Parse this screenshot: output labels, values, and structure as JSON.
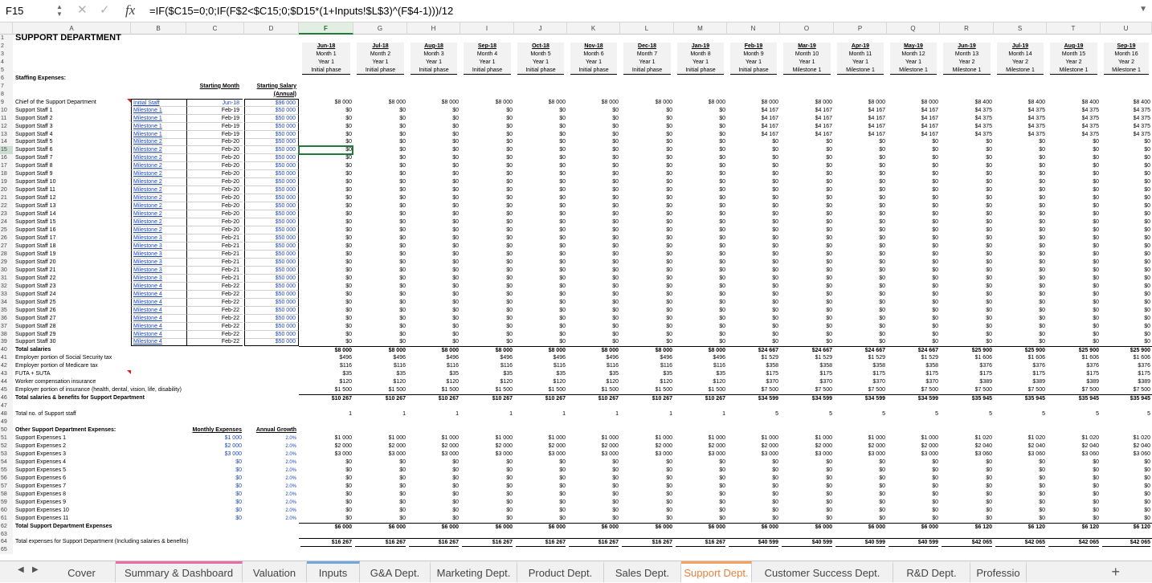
{
  "formula_bar": {
    "name_box": "F15",
    "fx_label": "fx",
    "formula": "=IF($C15=0;0;IF(F$2<$C15;0;$D15*(1+Inputs!$L$3)^(F$4-1)))/12"
  },
  "column_headers": [
    "A",
    "B",
    "C",
    "D",
    "F",
    "G",
    "H",
    "I",
    "J",
    "K",
    "L",
    "M",
    "N",
    "O",
    "P",
    "Q",
    "R",
    "S",
    "T",
    "U"
  ],
  "selected_column": "F",
  "title": "SUPPORT DEPARTMENT",
  "months": [
    {
      "date": "Jun-18",
      "month": "Month 1",
      "year": "Year 1",
      "phase": "Initial phase"
    },
    {
      "date": "Jul-18",
      "month": "Month 2",
      "year": "Year 1",
      "phase": "Initial phase"
    },
    {
      "date": "Aug-18",
      "month": "Month 3",
      "year": "Year 1",
      "phase": "Initial phase"
    },
    {
      "date": "Sep-18",
      "month": "Month 4",
      "year": "Year 1",
      "phase": "Initial phase"
    },
    {
      "date": "Oct-18",
      "month": "Month 5",
      "year": "Year 1",
      "phase": "Initial phase"
    },
    {
      "date": "Nov-18",
      "month": "Month 6",
      "year": "Year 1",
      "phase": "Initial phase"
    },
    {
      "date": "Dec-18",
      "month": "Month 7",
      "year": "Year 1",
      "phase": "Initial phase"
    },
    {
      "date": "Jan-19",
      "month": "Month 8",
      "year": "Year 1",
      "phase": "Initial phase"
    },
    {
      "date": "Feb-19",
      "month": "Month 9",
      "year": "Year 1",
      "phase": "Initial phase"
    },
    {
      "date": "Mar-19",
      "month": "Month 10",
      "year": "Year 1",
      "phase": "Milestone 1"
    },
    {
      "date": "Apr-19",
      "month": "Month 11",
      "year": "Year 1",
      "phase": "Milestone 1"
    },
    {
      "date": "May-19",
      "month": "Month 12",
      "year": "Year 1",
      "phase": "Milestone 1"
    },
    {
      "date": "Jun-19",
      "month": "Month 13",
      "year": "Year 2",
      "phase": "Milestone 1"
    },
    {
      "date": "Jul-19",
      "month": "Month 14",
      "year": "Year 2",
      "phase": "Milestone 1"
    },
    {
      "date": "Aug-19",
      "month": "Month 15",
      "year": "Year 2",
      "phase": "Milestone 1"
    },
    {
      "date": "Sep-19",
      "month": "Month 16",
      "year": "Year 2",
      "phase": "Milestone 1"
    }
  ],
  "staffing_label": "Staffing Expenses:",
  "starting_month_header": "Starting Month",
  "starting_salary_header": "Starting Salary",
  "starting_salary_header2": "(Annual)",
  "staff": [
    {
      "name": "Chief of the Support Department",
      "milestone": "Initial Staff",
      "start": "Jun-18",
      "salary": "$96 000"
    },
    {
      "name": "Support Staff 1",
      "milestone": "Milestone 1",
      "start": "Feb-19",
      "salary": "$50 000"
    },
    {
      "name": "Support Staff 2",
      "milestone": "Milestone 1",
      "start": "Feb-19",
      "salary": "$50 000"
    },
    {
      "name": "Support Staff 3",
      "milestone": "Milestone 1",
      "start": "Feb-19",
      "salary": "$50 000"
    },
    {
      "name": "Support Staff 4",
      "milestone": "Milestone 1",
      "start": "Feb-19",
      "salary": "$50 000"
    },
    {
      "name": "Support Staff 5",
      "milestone": "Milestone 2",
      "start": "Feb-20",
      "salary": "$50 000"
    },
    {
      "name": "Support Staff 6",
      "milestone": "Milestone 2",
      "start": "Feb-20",
      "salary": "$50 000"
    },
    {
      "name": "Support Staff 7",
      "milestone": "Milestone 2",
      "start": "Feb-20",
      "salary": "$50 000"
    },
    {
      "name": "Support Staff 8",
      "milestone": "Milestone 2",
      "start": "Feb-20",
      "salary": "$50 000"
    },
    {
      "name": "Support Staff 9",
      "milestone": "Milestone 2",
      "start": "Feb-20",
      "salary": "$50 000"
    },
    {
      "name": "Support Staff 10",
      "milestone": "Milestone 2",
      "start": "Feb-20",
      "salary": "$50 000"
    },
    {
      "name": "Support Staff 11",
      "milestone": "Milestone 2",
      "start": "Feb-20",
      "salary": "$50 000"
    },
    {
      "name": "Support Staff 12",
      "milestone": "Milestone 2",
      "start": "Feb-20",
      "salary": "$50 000"
    },
    {
      "name": "Support Staff 13",
      "milestone": "Milestone 2",
      "start": "Feb-20",
      "salary": "$50 000"
    },
    {
      "name": "Support Staff 14",
      "milestone": "Milestone 2",
      "start": "Feb-20",
      "salary": "$50 000"
    },
    {
      "name": "Support Staff 15",
      "milestone": "Milestone 2",
      "start": "Feb-20",
      "salary": "$50 000"
    },
    {
      "name": "Support Staff 16",
      "milestone": "Milestone 2",
      "start": "Feb-20",
      "salary": "$50 000"
    },
    {
      "name": "Support Staff 17",
      "milestone": "Milestone 3",
      "start": "Feb-21",
      "salary": "$50 000"
    },
    {
      "name": "Support Staff 18",
      "milestone": "Milestone 3",
      "start": "Feb-21",
      "salary": "$50 000"
    },
    {
      "name": "Support Staff 19",
      "milestone": "Milestone 3",
      "start": "Feb-21",
      "salary": "$50 000"
    },
    {
      "name": "Support Staff 20",
      "milestone": "Milestone 3",
      "start": "Feb-21",
      "salary": "$50 000"
    },
    {
      "name": "Support Staff 21",
      "milestone": "Milestone 3",
      "start": "Feb-21",
      "salary": "$50 000"
    },
    {
      "name": "Support Staff 22",
      "milestone": "Milestone 3",
      "start": "Feb-21",
      "salary": "$50 000"
    },
    {
      "name": "Support Staff 23",
      "milestone": "Milestone 4",
      "start": "Feb-22",
      "salary": "$50 000"
    },
    {
      "name": "Support Staff 24",
      "milestone": "Milestone 4",
      "start": "Feb-22",
      "salary": "$50 000"
    },
    {
      "name": "Support Staff 25",
      "milestone": "Milestone 4",
      "start": "Feb-22",
      "salary": "$50 000"
    },
    {
      "name": "Support Staff 26",
      "milestone": "Milestone 4",
      "start": "Feb-22",
      "salary": "$50 000"
    },
    {
      "name": "Support Staff 27",
      "milestone": "Milestone 4",
      "start": "Feb-22",
      "salary": "$50 000"
    },
    {
      "name": "Support Staff 28",
      "milestone": "Milestone 4",
      "start": "Feb-22",
      "salary": "$50 000"
    },
    {
      "name": "Support Staff 29",
      "milestone": "Milestone 4",
      "start": "Feb-22",
      "salary": "$50 000"
    },
    {
      "name": "Support Staff 30",
      "milestone": "Milestone 4",
      "start": "Feb-22",
      "salary": "$50 000"
    }
  ],
  "staff_values": {
    "chief": [
      "$8 000",
      "$8 000",
      "$8 000",
      "$8 000",
      "$8 000",
      "$8 000",
      "$8 000",
      "$8 000",
      "$8 000",
      "$8 000",
      "$8 000",
      "$8 000",
      "$8 400",
      "$8 400",
      "$8 400",
      "$8 400"
    ],
    "milestone1": [
      "$0",
      "$0",
      "$0",
      "$0",
      "$0",
      "$0",
      "$0",
      "$0",
      "$4 167",
      "$4 167",
      "$4 167",
      "$4 167",
      "$4 375",
      "$4 375",
      "$4 375",
      "$4 375"
    ],
    "zero": "$0"
  },
  "totals": [
    {
      "label": "Total salaries",
      "bold": true,
      "values": [
        "$8 000",
        "$8 000",
        "$8 000",
        "$8 000",
        "$8 000",
        "$8 000",
        "$8 000",
        "$8 000",
        "$24 667",
        "$24 667",
        "$24 667",
        "$24 667",
        "$25 900",
        "$25 900",
        "$25 900",
        "$25 900"
      ]
    },
    {
      "label": "Employer portion of Social Security tax",
      "bold": false,
      "values": [
        "$496",
        "$496",
        "$496",
        "$496",
        "$496",
        "$496",
        "$496",
        "$496",
        "$1 529",
        "$1 529",
        "$1 529",
        "$1 529",
        "$1 606",
        "$1 606",
        "$1 606",
        "$1 606"
      ]
    },
    {
      "label": "Employer portion of Medicare tax",
      "bold": false,
      "values": [
        "$116",
        "$116",
        "$116",
        "$116",
        "$116",
        "$116",
        "$116",
        "$116",
        "$358",
        "$358",
        "$358",
        "$358",
        "$376",
        "$376",
        "$376",
        "$376"
      ]
    },
    {
      "label": "FUTA + SUTA",
      "bold": false,
      "values": [
        "$35",
        "$35",
        "$35",
        "$35",
        "$35",
        "$35",
        "$35",
        "$35",
        "$175",
        "$175",
        "$175",
        "$175",
        "$175",
        "$175",
        "$175",
        "$175"
      ]
    },
    {
      "label": "Worker compensation insurance",
      "bold": false,
      "values": [
        "$120",
        "$120",
        "$120",
        "$120",
        "$120",
        "$120",
        "$120",
        "$120",
        "$370",
        "$370",
        "$370",
        "$370",
        "$389",
        "$389",
        "$389",
        "$389"
      ]
    },
    {
      "label": "Employer portion of insurance (health, dental, vision, life, disability)",
      "bold": false,
      "values": [
        "$1 500",
        "$1 500",
        "$1 500",
        "$1 500",
        "$1 500",
        "$1 500",
        "$1 500",
        "$1 500",
        "$7 500",
        "$7 500",
        "$7 500",
        "$7 500",
        "$7 500",
        "$7 500",
        "$7 500",
        "$7 500"
      ]
    },
    {
      "label": "Total salaries & benefits for Support Department",
      "bold": true,
      "values": [
        "$10 267",
        "$10 267",
        "$10 267",
        "$10 267",
        "$10 267",
        "$10 267",
        "$10 267",
        "$10 267",
        "$34 599",
        "$34 599",
        "$34 599",
        "$34 599",
        "$35 945",
        "$35 945",
        "$35 945",
        "$35 945"
      ]
    }
  ],
  "staff_count": {
    "label": "Total no. of Support staff",
    "values": [
      "1",
      "1",
      "1",
      "1",
      "1",
      "1",
      "1",
      "1",
      "5",
      "5",
      "5",
      "5",
      "5",
      "5",
      "5",
      "5"
    ]
  },
  "other_label": "Other Support Department Expenses:",
  "monthly_expenses_header": "Monthly Expenses",
  "annual_growth_header": "Annual Growth",
  "other_expenses": [
    {
      "name": "Support Expenses 1",
      "monthly": "$1 000",
      "growth": "2.0%",
      "values": [
        "$1 000",
        "$1 000",
        "$1 000",
        "$1 000",
        "$1 000",
        "$1 000",
        "$1 000",
        "$1 000",
        "$1 000",
        "$1 000",
        "$1 000",
        "$1 000",
        "$1 020",
        "$1 020",
        "$1 020",
        "$1 020"
      ]
    },
    {
      "name": "Support Expenses 2",
      "monthly": "$2 000",
      "growth": "2.0%",
      "values": [
        "$2 000",
        "$2 000",
        "$2 000",
        "$2 000",
        "$2 000",
        "$2 000",
        "$2 000",
        "$2 000",
        "$2 000",
        "$2 000",
        "$2 000",
        "$2 000",
        "$2 040",
        "$2 040",
        "$2 040",
        "$2 040"
      ]
    },
    {
      "name": "Support Expenses 3",
      "monthly": "$3 000",
      "growth": "2.0%",
      "values": [
        "$3 000",
        "$3 000",
        "$3 000",
        "$3 000",
        "$3 000",
        "$3 000",
        "$3 000",
        "$3 000",
        "$3 000",
        "$3 000",
        "$3 000",
        "$3 000",
        "$3 060",
        "$3 060",
        "$3 060",
        "$3 060"
      ]
    },
    {
      "name": "Support Expenses 4",
      "monthly": "$0",
      "growth": "2.0%",
      "values": []
    },
    {
      "name": "Support Expenses 5",
      "monthly": "$0",
      "growth": "2.0%",
      "values": []
    },
    {
      "name": "Support Expenses 6",
      "monthly": "$0",
      "growth": "2.0%",
      "values": []
    },
    {
      "name": "Support Expenses 7",
      "monthly": "$0",
      "growth": "2.0%",
      "values": []
    },
    {
      "name": "Support Expenses 8",
      "monthly": "$0",
      "growth": "2.0%",
      "values": []
    },
    {
      "name": "Support Expenses 9",
      "monthly": "$0",
      "growth": "2.0%",
      "values": []
    },
    {
      "name": "Support Expenses 10",
      "monthly": "$0",
      "growth": "2.0%",
      "values": []
    },
    {
      "name": "Support Expenses 11",
      "monthly": "$0",
      "growth": "2.0%",
      "values": []
    }
  ],
  "total_other": {
    "label": "Total Support Department Expenses",
    "values": [
      "$6 000",
      "$6 000",
      "$6 000",
      "$6 000",
      "$6 000",
      "$6 000",
      "$6 000",
      "$6 000",
      "$6 000",
      "$6 000",
      "$6 000",
      "$6 000",
      "$6 120",
      "$6 120",
      "$6 120",
      "$6 120"
    ]
  },
  "grand_total": {
    "label": "Total expenses for Support Department (Including salaries & benefits)",
    "values": [
      "$16 267",
      "$16 267",
      "$16 267",
      "$16 267",
      "$16 267",
      "$16 267",
      "$16 267",
      "$16 267",
      "$40 599",
      "$40 599",
      "$40 599",
      "$40 599",
      "$42 065",
      "$42 065",
      "$42 065",
      "$42 065"
    ]
  },
  "tabs": [
    {
      "label": "Cover",
      "color": ""
    },
    {
      "label": "Summary & Dashboard",
      "color": "#e86aa8"
    },
    {
      "label": "Valuation",
      "color": ""
    },
    {
      "label": "Inputs",
      "color": "#6fa8dc"
    },
    {
      "label": "G&A Dept.",
      "color": ""
    },
    {
      "label": "Marketing Dept.",
      "color": ""
    },
    {
      "label": "Product Dept.",
      "color": ""
    },
    {
      "label": "Sales Dept.",
      "color": ""
    },
    {
      "label": "Support Dept.",
      "color": "#f4a460",
      "active": true
    },
    {
      "label": "Customer Success Dept.",
      "color": ""
    },
    {
      "label": "R&D Dept.",
      "color": ""
    },
    {
      "label": "Professio",
      "color": ""
    }
  ],
  "colors": {
    "selection": "#227a3c",
    "link": "#1a47b8",
    "active_tab_text": "#e8823a"
  }
}
